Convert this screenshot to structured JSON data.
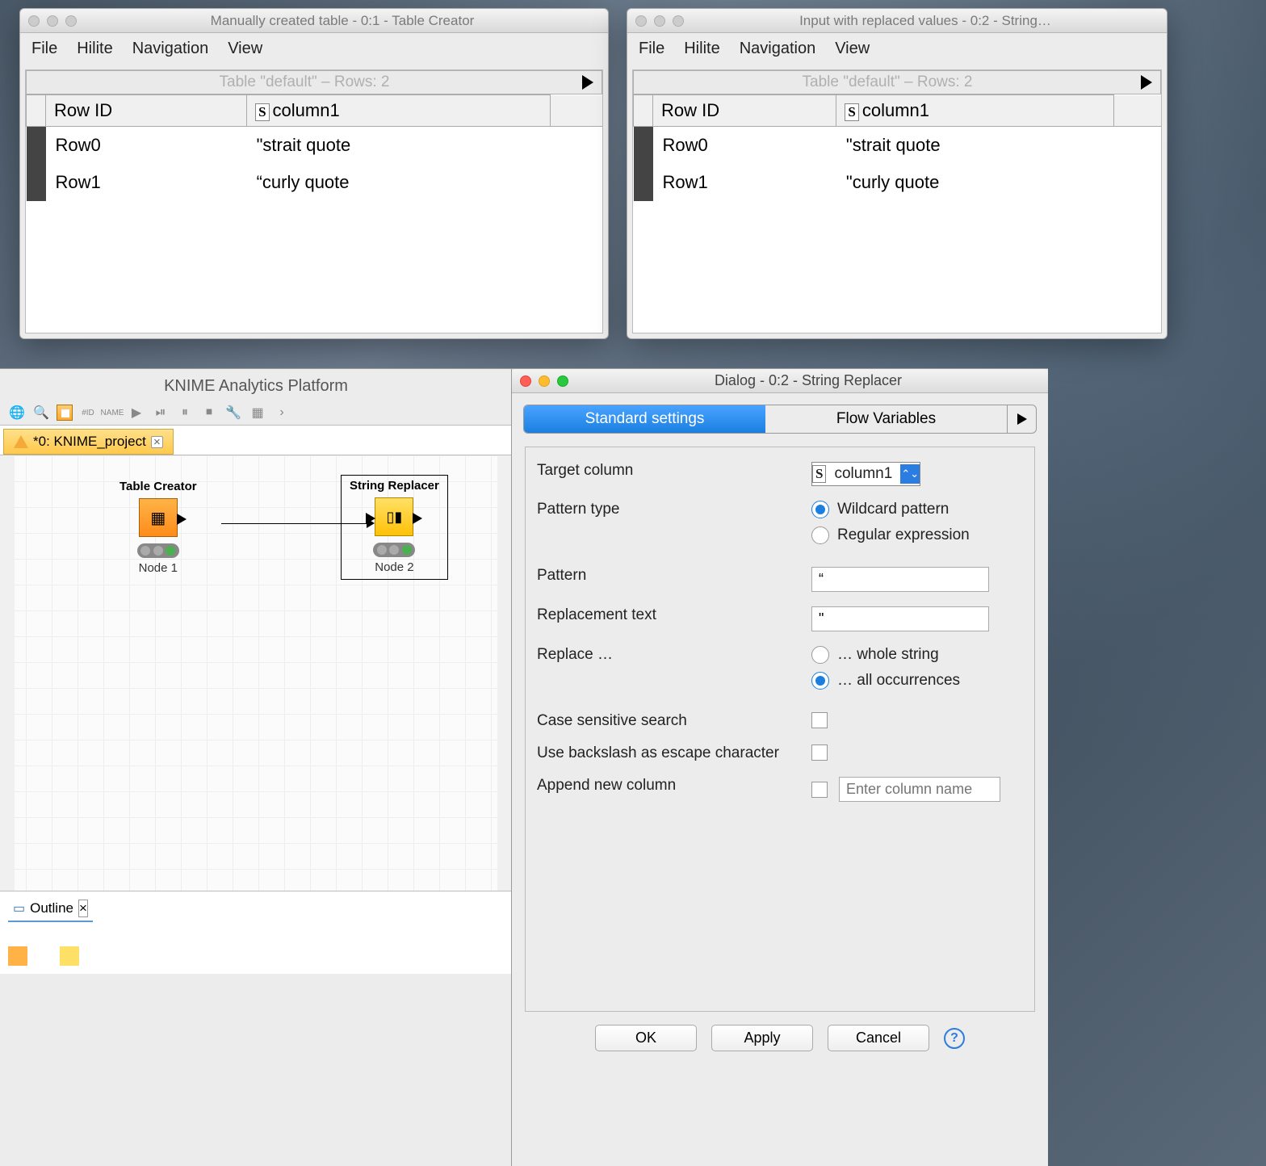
{
  "window_left": {
    "title": "Manually created table - 0:1 - Table Creator",
    "menu": [
      "File",
      "Hilite",
      "Navigation",
      "View"
    ],
    "table_header": "Table \"default\" – Rows: 2",
    "columns": [
      "Row ID",
      "column1"
    ],
    "rows": [
      {
        "id": "Row0",
        "col1": "\"strait quote"
      },
      {
        "id": "Row1",
        "col1": "“curly quote"
      }
    ]
  },
  "window_right": {
    "title": "Input with replaced values - 0:2 - String…",
    "menu": [
      "File",
      "Hilite",
      "Navigation",
      "View"
    ],
    "table_header": "Table \"default\" – Rows: 2",
    "columns": [
      "Row ID",
      "column1"
    ],
    "rows": [
      {
        "id": "Row0",
        "col1": "\"strait quote"
      },
      {
        "id": "Row1",
        "col1": "\"curly quote"
      }
    ]
  },
  "knime": {
    "title": "KNIME Analytics Platform",
    "tab": "*0: KNIME_project",
    "nodes": {
      "n1": {
        "title": "Table Creator",
        "label": "Node 1"
      },
      "n2": {
        "title": "String Replacer",
        "label": "Node 2"
      }
    },
    "outline_label": "Outline"
  },
  "dialog": {
    "title": "Dialog - 0:2 - String Replacer",
    "tabs": {
      "standard": "Standard settings",
      "flow": "Flow Variables"
    },
    "form": {
      "target_label": "Target column",
      "target_value": "column1",
      "pattern_type_label": "Pattern type",
      "pattern_type_wildcard": "Wildcard pattern",
      "pattern_type_regex": "Regular expression",
      "pattern_label": "Pattern",
      "pattern_value": "“",
      "replacement_label": "Replacement text",
      "replacement_value": "\"",
      "replace_label": "Replace …",
      "replace_whole": "… whole string",
      "replace_all": "… all occurrences",
      "case_label": "Case sensitive search",
      "backslash_label": "Use backslash as escape character",
      "append_label": "Append new column",
      "append_placeholder": "Enter column name"
    },
    "buttons": {
      "ok": "OK",
      "apply": "Apply",
      "cancel": "Cancel"
    }
  }
}
